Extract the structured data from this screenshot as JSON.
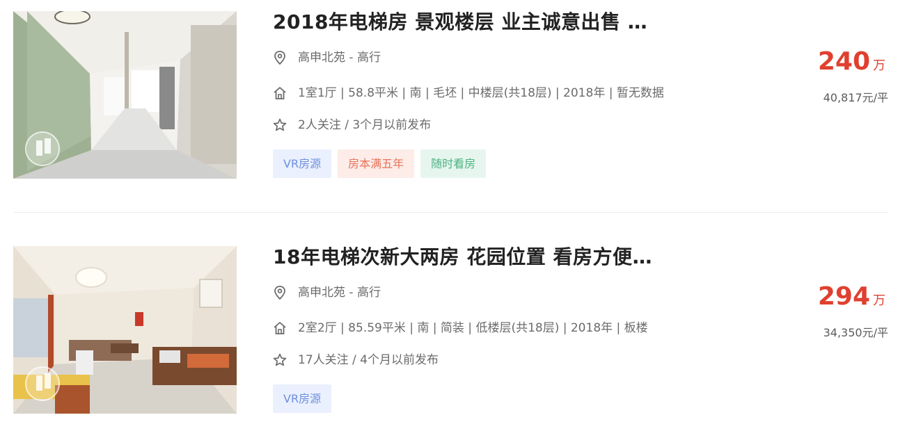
{
  "listings": [
    {
      "title": "2018年电梯房 景观楼层 业主诚意出售 …",
      "location": "高申北苑 - 高行",
      "house_info": "1室1厅 | 58.8平米 | 南 | 毛坯 | 中楼层(共18层) | 2018年 | 暂无数据",
      "follow_info": "2人关注 / 3个月以前发布",
      "tags": [
        "VR房源",
        "房本满五年",
        "随时看房"
      ],
      "total_price": "240",
      "price_unit": "万",
      "unit_price": "40,817元/平"
    },
    {
      "title": "18年电梯次新大两房 花园位置 看房方便…",
      "location": "高申北苑 - 高行",
      "house_info": "2室2厅 | 85.59平米 | 南 | 简装 | 低楼层(共18层) | 2018年 | 板楼",
      "follow_info": "17人关注 / 4个月以前发布",
      "tags": [
        "VR房源"
      ],
      "total_price": "294",
      "price_unit": "万",
      "unit_price": "34,350元/平"
    }
  ],
  "icons": {
    "location": "map-pin-icon",
    "house": "house-icon",
    "follow": "star-icon",
    "vr_badge": "vr-badge-icon"
  },
  "colors": {
    "price": "#e0402f",
    "tag_vr_bg": "#eaf0fd",
    "tag_vr_text": "#6e8fe0",
    "tag_five_bg": "#fdece8",
    "tag_five_text": "#e8735a",
    "tag_visit_bg": "#e6f6ee",
    "tag_visit_text": "#4db281"
  }
}
